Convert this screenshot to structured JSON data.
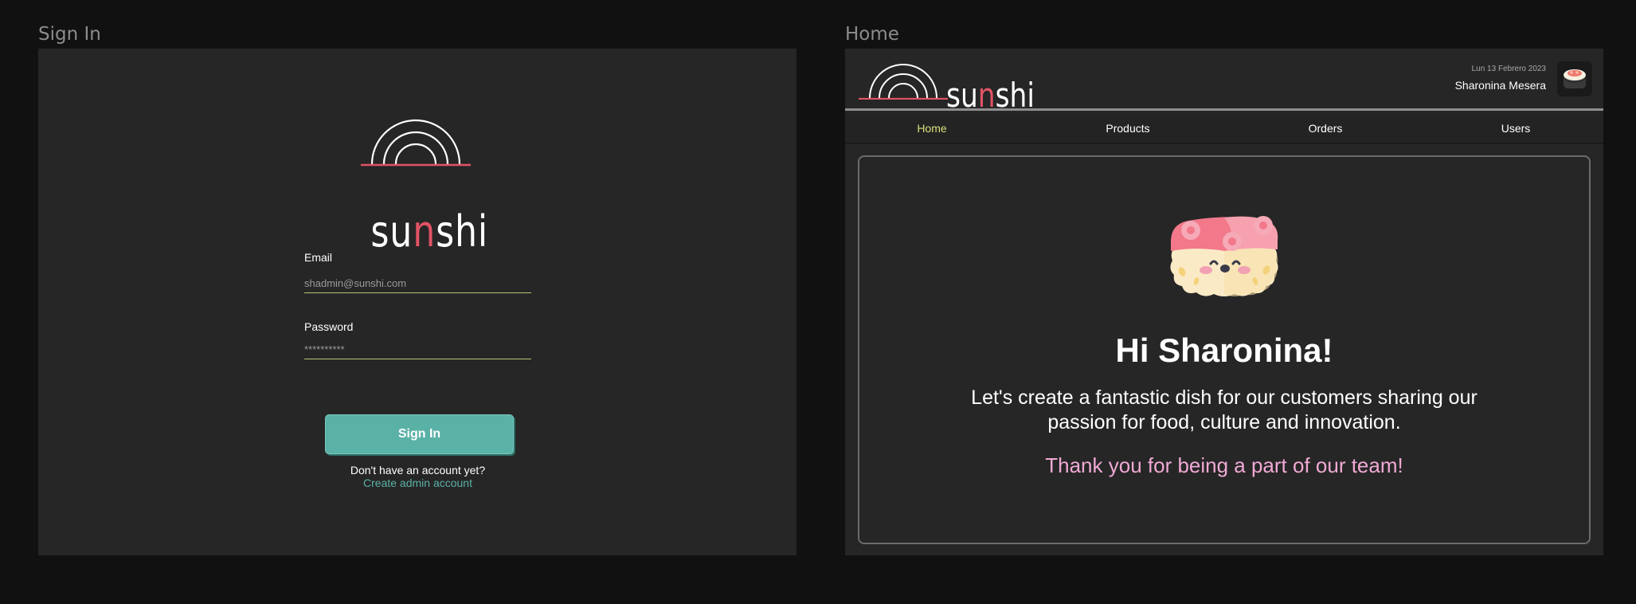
{
  "frames": {
    "signin_label": "Sign In",
    "home_label": "Home"
  },
  "brand": {
    "word_before": "su",
    "word_accent": "n",
    "word_after": "shi",
    "accent_color": "#e05365"
  },
  "signin": {
    "email_label": "Email",
    "email_placeholder": "shadmin@sunshi.com",
    "password_label": "Password",
    "password_placeholder": "**********",
    "button_label": "Sign In",
    "no_account_text": "Don't have an account yet?",
    "create_link_text": "Create admin account"
  },
  "home": {
    "header": {
      "date": "Lun 13 Febrero 2023",
      "user_name": "Sharonina Mesera"
    },
    "nav": {
      "items": [
        {
          "label": "Home",
          "active": true
        },
        {
          "label": "Products",
          "active": false
        },
        {
          "label": "Orders",
          "active": false
        },
        {
          "label": "Users",
          "active": false
        }
      ]
    },
    "greeting": "Hi Sharonina!",
    "message": "Let's create a fantastic dish for our customers sharing our passion for food, culture and innovation.",
    "thanks": "Thank you for being a part of our team!"
  },
  "colors": {
    "teal": "#5ab1a6",
    "active_nav": "#d8e07c",
    "thanks_pink": "#f0a9d4"
  }
}
